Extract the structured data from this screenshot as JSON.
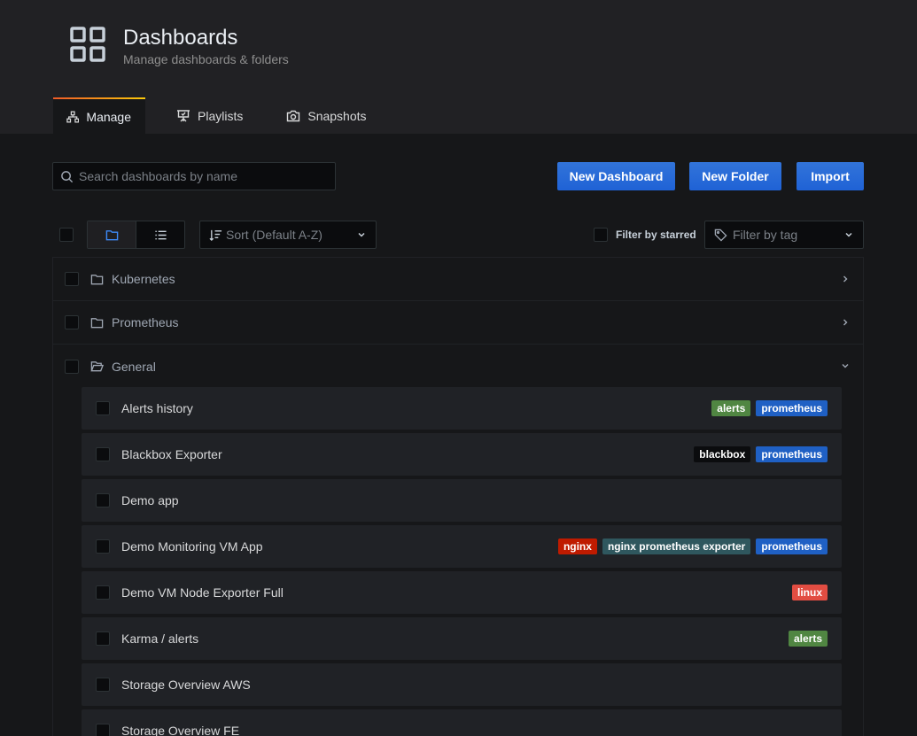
{
  "header": {
    "title": "Dashboards",
    "subtitle": "Manage dashboards & folders",
    "icon": "dashboard-grid-icon"
  },
  "tabs": [
    {
      "label": "Manage",
      "icon": "sitemap-icon",
      "active": true
    },
    {
      "label": "Playlists",
      "icon": "presentation-icon",
      "active": false
    },
    {
      "label": "Snapshots",
      "icon": "camera-icon",
      "active": false
    }
  ],
  "search": {
    "placeholder": "Search dashboards by name"
  },
  "actions": {
    "new_dashboard": "New Dashboard",
    "new_folder": "New Folder",
    "import": "Import"
  },
  "controls": {
    "sort_label": "Sort (Default A-Z)",
    "filter_starred": "Filter by starred",
    "filter_tag_placeholder": "Filter by tag"
  },
  "folders": [
    {
      "name": "Kubernetes",
      "expanded": false
    },
    {
      "name": "Prometheus",
      "expanded": false
    },
    {
      "name": "General",
      "expanded": true
    }
  ],
  "dashboards": [
    {
      "title": "Alerts history",
      "tags": [
        {
          "label": "alerts",
          "color": "#508642"
        },
        {
          "label": "prometheus",
          "color": "#1f60c4"
        }
      ]
    },
    {
      "title": "Blackbox Exporter",
      "tags": [
        {
          "label": "blackbox",
          "color": "#0b0c0e"
        },
        {
          "label": "prometheus",
          "color": "#1f60c4"
        }
      ]
    },
    {
      "title": "Demo app",
      "tags": []
    },
    {
      "title": "Demo Monitoring VM App",
      "tags": [
        {
          "label": "nginx",
          "color": "#bf1b00"
        },
        {
          "label": "nginx prometheus exporter",
          "color": "#2f575e"
        },
        {
          "label": "prometheus",
          "color": "#1f60c4"
        }
      ]
    },
    {
      "title": "Demo VM Node Exporter Full",
      "tags": [
        {
          "label": "linux",
          "color": "#e24d42"
        }
      ]
    },
    {
      "title": "Karma / alerts",
      "tags": [
        {
          "label": "alerts",
          "color": "#508642"
        }
      ]
    },
    {
      "title": "Storage Overview AWS",
      "tags": []
    },
    {
      "title": "Storage Overview FE",
      "tags": []
    }
  ],
  "colors": {
    "accent": "#3274d9",
    "background": "#161719",
    "panel": "#202226"
  }
}
